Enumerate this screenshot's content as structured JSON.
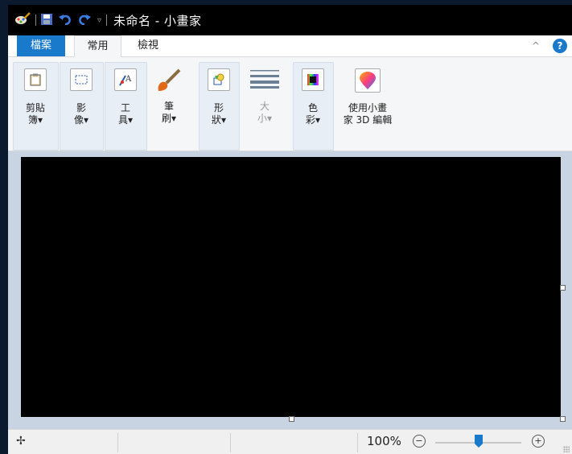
{
  "window": {
    "title": "未命名 - 小畫家"
  },
  "tabs": [
    {
      "label": "檔案"
    },
    {
      "label": "常用"
    },
    {
      "label": "檢視"
    }
  ],
  "ribbon": {
    "clipboard": "剪貼\n簿▾",
    "image": "影\n像▾",
    "tools": "工\n具▾",
    "brushes": "筆\n刷▾",
    "shapes": "形\n狀▾",
    "size": "大\n小▾",
    "colors": "色\n彩▾",
    "paint3d": "使用小畫\n家 3D 編輯"
  },
  "status": {
    "zoom": "100%"
  },
  "zoom_level_percent": 100,
  "colors": {
    "accent": "#1979ca",
    "titlebar": "#000000",
    "canvas": "#000000"
  }
}
